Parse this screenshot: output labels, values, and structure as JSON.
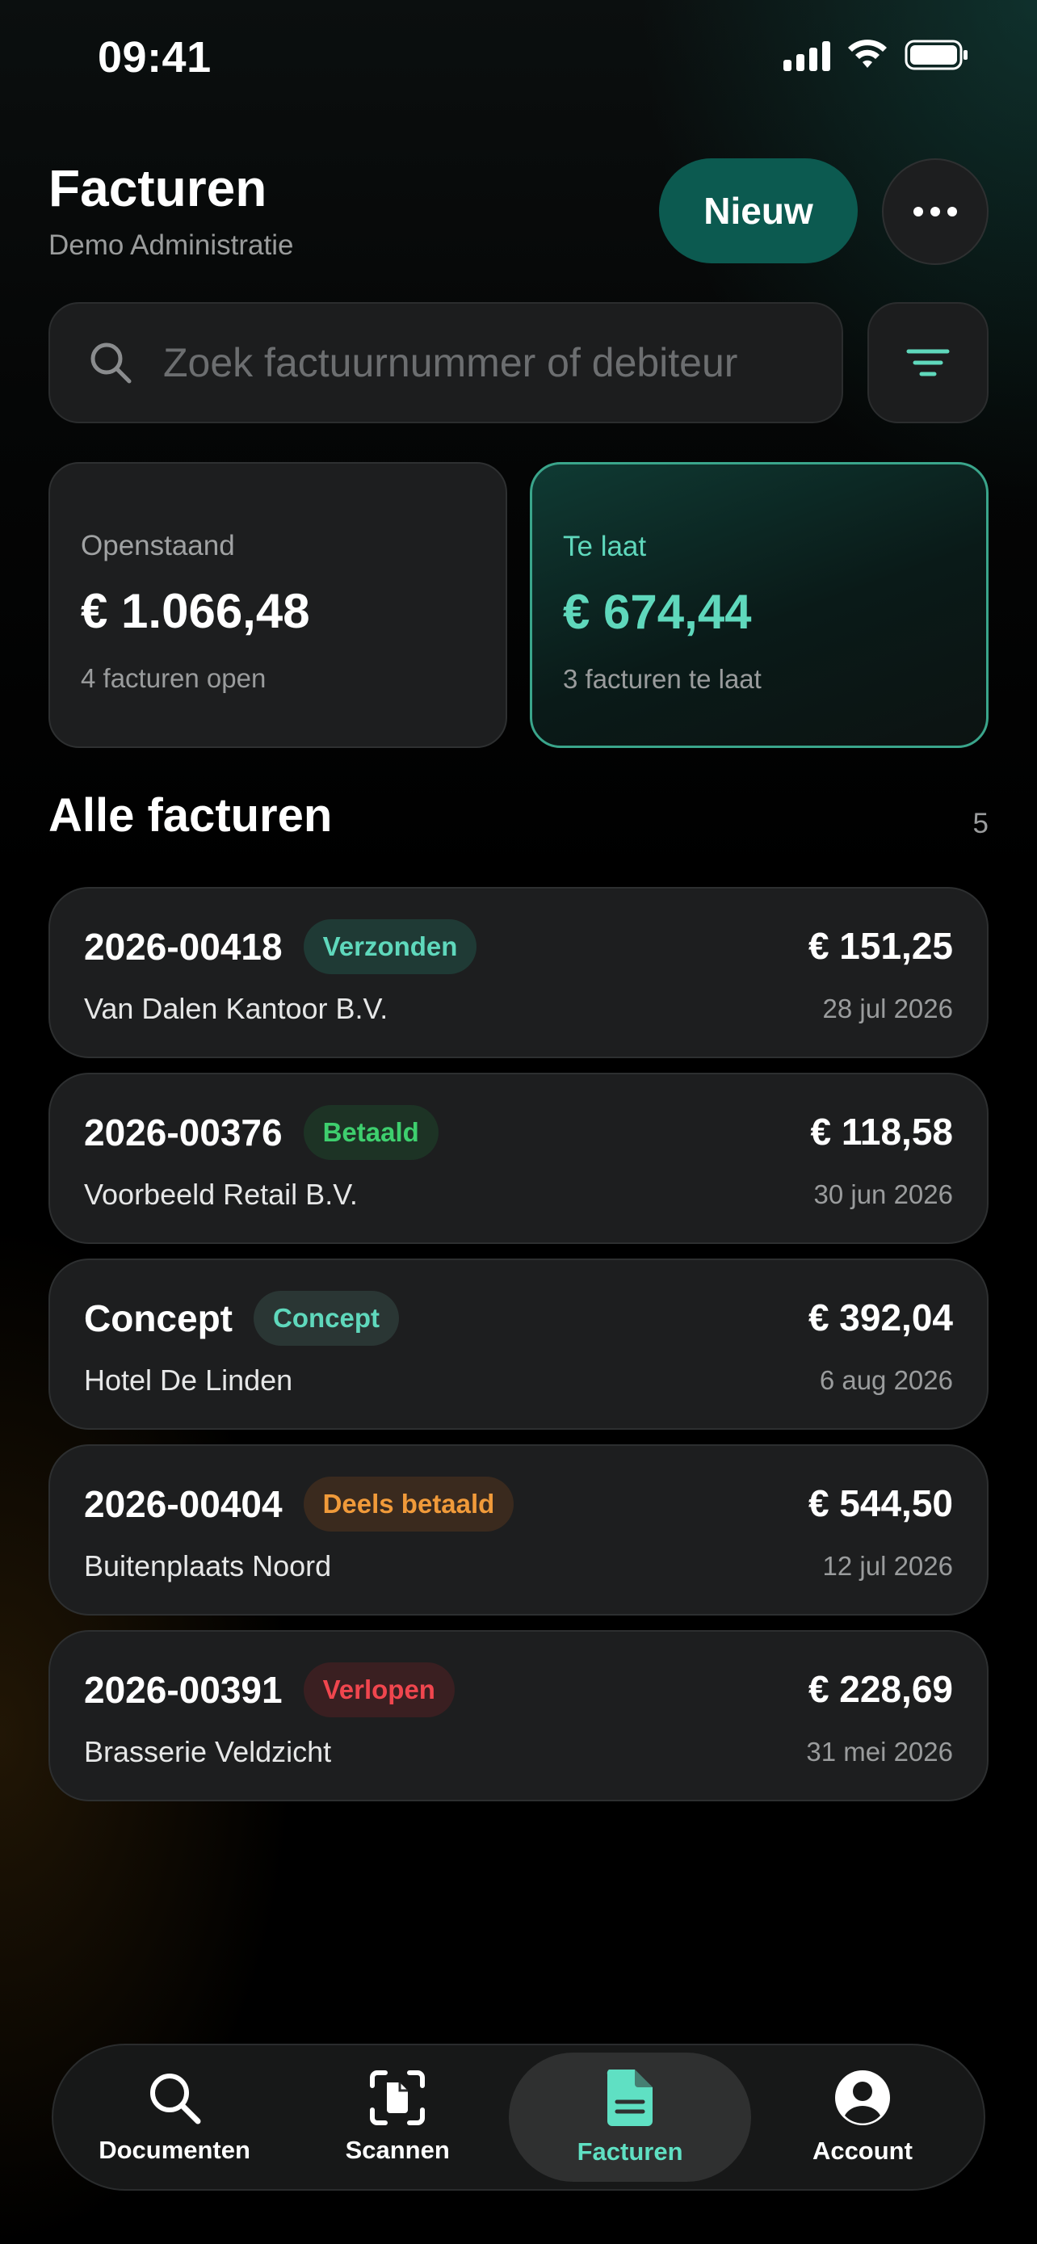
{
  "status_bar": {
    "time": "09:41"
  },
  "header": {
    "title": "Facturen",
    "subtitle": "Demo Administratie",
    "new_label": "Nieuw"
  },
  "search": {
    "placeholder": "Zoek factuurnummer of debiteur",
    "value": ""
  },
  "stats": {
    "open": {
      "label": "Openstaand",
      "value": "€ 1.066,48",
      "sub": "4 facturen open"
    },
    "late": {
      "label": "Te laat",
      "value": "€ 674,44",
      "sub": "3 facturen te laat"
    }
  },
  "section": {
    "title": "Alle facturen",
    "count": "5"
  },
  "invoices": [
    {
      "number": "2026-00418",
      "status": "Verzonden",
      "status_color": "#5fd8bc",
      "status_bg": "#1f3a35",
      "client": "Van Dalen Kantoor B.V.",
      "amount": "€ 151,25",
      "date": "28 jul 2026"
    },
    {
      "number": "2026-00376",
      "status": "Betaald",
      "status_color": "#3ecf6e",
      "status_bg": "#1d3325",
      "client": "Voorbeeld Retail B.V.",
      "amount": "€ 118,58",
      "date": "30 jun 2026"
    },
    {
      "number": "Concept",
      "status": "Concept",
      "status_color": "#5fd8bc",
      "status_bg": "#2a3634",
      "client": "Hotel De Linden",
      "amount": "€ 392,04",
      "date": "6 aug 2026"
    },
    {
      "number": "2026-00404",
      "status": "Deels betaald",
      "status_color": "#f09a3a",
      "status_bg": "#3a2a1e",
      "client": "Buitenplaats Noord",
      "amount": "€ 544,50",
      "date": "12 jul 2026"
    },
    {
      "number": "2026-00391",
      "status": "Verlopen",
      "status_color": "#f0464e",
      "status_bg": "#3a1f21",
      "client": "Brasserie Veldzicht",
      "amount": "€ 228,69",
      "date": "31 mei 2026"
    }
  ],
  "tabs": [
    {
      "label": "Documenten",
      "icon": "search-icon",
      "active": false
    },
    {
      "label": "Scannen",
      "icon": "scan-document-icon",
      "active": false
    },
    {
      "label": "Facturen",
      "icon": "document-icon",
      "active": true
    },
    {
      "label": "Account",
      "icon": "account-icon",
      "active": false
    }
  ],
  "colors": {
    "accent": "#5fd8bc",
    "primary_button": "#0c5a50"
  }
}
